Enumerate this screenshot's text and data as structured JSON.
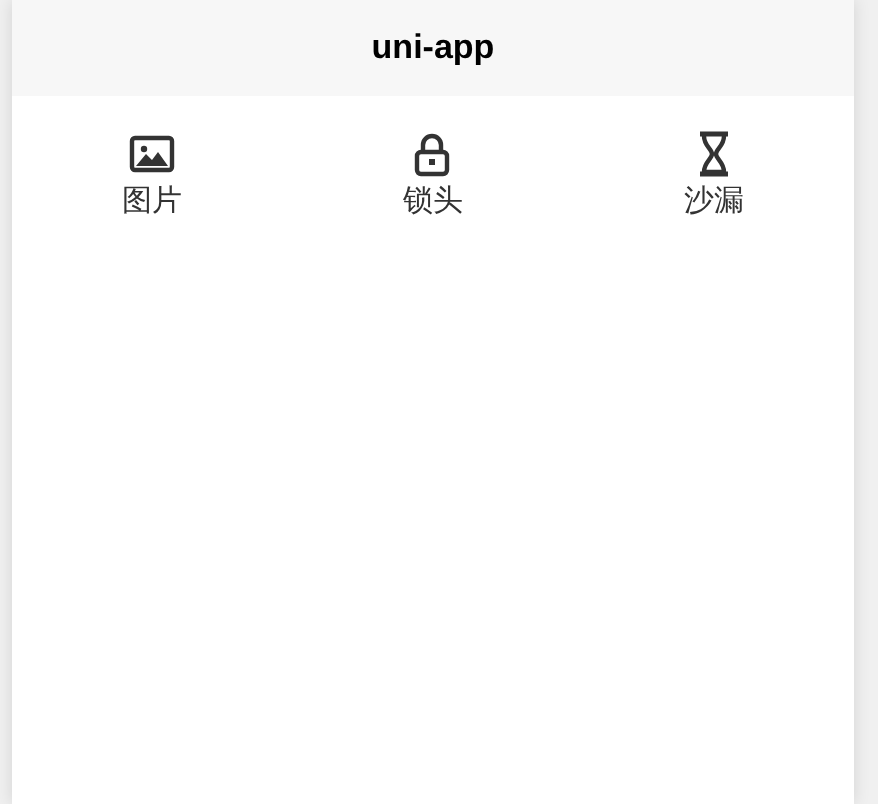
{
  "navbar": {
    "title": "uni-app"
  },
  "items": [
    {
      "kind": "image",
      "label": "图片"
    },
    {
      "kind": "lock",
      "label": "锁头"
    },
    {
      "kind": "hourglass",
      "label": "沙漏"
    }
  ]
}
